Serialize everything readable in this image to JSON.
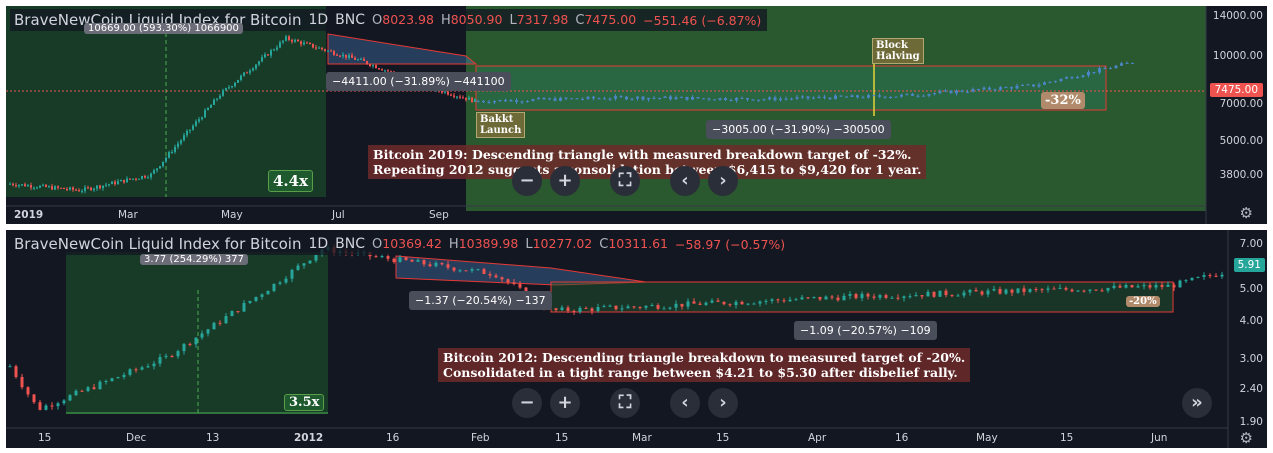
{
  "panels": [
    {
      "header": {
        "title": "BraveNewCoin Liquid Index for Bitcoin",
        "interval": "1D",
        "exchange": "BNC",
        "o_label": "O",
        "o_value": "8023.98",
        "h_label": "H",
        "h_value": "8050.90",
        "l_label": "L",
        "l_value": "7317.98",
        "c_label": "C",
        "c_value": "7475.00",
        "change": "−551.46 (−6.87%)"
      },
      "y_ticks": [
        "14000.00",
        "10000.00",
        "7000.00",
        "5000.00",
        "3800.00"
      ],
      "last_price": "7475.00",
      "x_ticks": [
        "2019",
        "Mar",
        "May",
        "Jul",
        "Sep"
      ],
      "annotations": {
        "gain": "4.4x",
        "partial_top": "10669.00 (593.30%) 1066900",
        "measure_1": "−4411.00 (−31.89%) −441100",
        "measure_2": "−3005.00 (−31.90%) −300500",
        "target": "-32%",
        "event_1": "Bakkt\nLaunch",
        "event_2": "Block\nHalving",
        "note_line1": "Bitcoin 2019: Descending triangle with measured breakdown target of -32%.",
        "note_line2": "Repeating 2012 suggests a consolidation between $6,415 to $9,420 for 1 year."
      }
    },
    {
      "header": {
        "title": "BraveNewCoin Liquid Index for Bitcoin",
        "interval": "1D",
        "exchange": "BNC",
        "o_label": "O",
        "o_value": "10369.42",
        "h_label": "H",
        "h_value": "10389.98",
        "l_label": "L",
        "l_value": "10277.02",
        "c_label": "C",
        "c_value": "10311.61",
        "change": "−58.97 (−0.57%)"
      },
      "y_ticks": [
        "7.00",
        "5.00",
        "4.00",
        "3.00",
        "2.40",
        "1.90"
      ],
      "last_price": "5.91",
      "x_ticks": [
        "15",
        "Dec",
        "13",
        "2012",
        "16",
        "Feb",
        "15",
        "Mar",
        "15",
        "Apr",
        "16",
        "May",
        "15",
        "Jun"
      ],
      "annotations": {
        "gain": "3.5x",
        "partial_top": "3.77 (254.29%) 377",
        "measure_1": "−1.37 (−20.54%) −137",
        "measure_2": "−1.09 (−20.57%) −109",
        "target": "-20%",
        "note_line1": "Bitcoin 2012: Descending triangle breakdown to measured target of -20%.",
        "note_line2": "Consolidated in a tight range between $4.21 to $5.30 after disbelief rally."
      }
    }
  ],
  "nav_buttons": {
    "minus": "−",
    "plus": "+",
    "fullscreen": "⛶",
    "prev": "‹",
    "next": "›",
    "end": "»"
  },
  "colors": {
    "bg": "#131722",
    "up": "#26a69a",
    "down": "#ef5350",
    "blue": "#4a86c5",
    "green_zone": "#3e8e3b",
    "gain_zone": "#1e5a2e",
    "note_bg": "#6b2a2a",
    "label_box": "#6e6a38"
  },
  "chart_data": [
    {
      "type": "candlestick",
      "title": "BraveNewCoin Liquid Index for Bitcoin",
      "y_scale": "log",
      "y_ticks": [
        14000,
        10000,
        7000,
        5000,
        3800
      ],
      "x_ticks": [
        "2019",
        "Mar",
        "May",
        "Jul",
        "Sep"
      ],
      "last": {
        "open": 8023.98,
        "high": 8050.9,
        "low": 7317.98,
        "close": 7475.0
      },
      "price_path": [
        {
          "date": "2019-01-01",
          "close": 3800
        },
        {
          "date": "2019-02-15",
          "close": 3600
        },
        {
          "date": "2019-04-01",
          "close": 4100
        },
        {
          "date": "2019-05-15",
          "close": 7900
        },
        {
          "date": "2019-06-26",
          "close": 12500
        },
        {
          "date": "2019-08-15",
          "close": 10300
        },
        {
          "date": "2019-09-24",
          "close": 8400
        },
        {
          "date": "2019-10-25",
          "close": 7475
        }
      ],
      "projection_range": [
        6415,
        9420
      ],
      "grid": false
    },
    {
      "type": "candlestick",
      "title": "BraveNewCoin Liquid Index for Bitcoin",
      "y_scale": "log",
      "y_ticks": [
        7.0,
        5.0,
        4.0,
        3.0,
        2.4,
        1.9
      ],
      "x_ticks": [
        "15",
        "Dec",
        "13",
        "2012",
        "16",
        "Feb",
        "15",
        "Mar",
        "15",
        "Apr",
        "16",
        "May",
        "15",
        "Jun"
      ],
      "last": {
        "open": 10369.42,
        "high": 10389.98,
        "low": 10277.02,
        "close": 10311.61
      },
      "price_path": [
        {
          "date": "2011-11-15",
          "close": 2.9
        },
        {
          "date": "2011-11-20",
          "close": 2.1
        },
        {
          "date": "2011-12-13",
          "close": 3.1
        },
        {
          "date": "2012-01-01",
          "close": 5.3
        },
        {
          "date": "2012-01-10",
          "close": 7.0
        },
        {
          "date": "2012-02-10",
          "close": 5.8
        },
        {
          "date": "2012-02-20",
          "close": 4.4
        },
        {
          "date": "2012-04-15",
          "close": 4.9
        },
        {
          "date": "2012-06-10",
          "close": 5.3
        },
        {
          "date": "2012-06-20",
          "close": 5.91
        }
      ],
      "consolidation_range": [
        4.21,
        5.3
      ],
      "grid": false
    }
  ]
}
